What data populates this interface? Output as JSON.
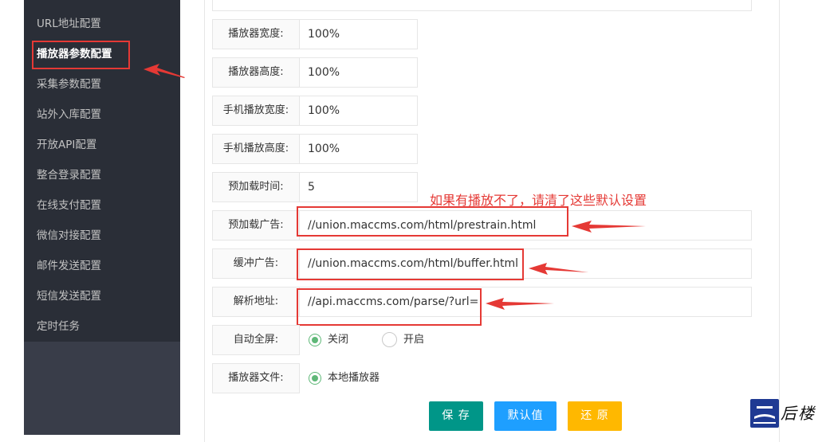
{
  "sidebar": {
    "items": [
      {
        "label": "URL地址配置"
      },
      {
        "label": "播放器参数配置"
      },
      {
        "label": "采集参数配置"
      },
      {
        "label": "站外入库配置"
      },
      {
        "label": "开放API配置"
      },
      {
        "label": "整合登录配置"
      },
      {
        "label": "在线支付配置"
      },
      {
        "label": "微信对接配置"
      },
      {
        "label": "邮件发送配置"
      },
      {
        "label": "短信发送配置"
      },
      {
        "label": "定时任务"
      }
    ],
    "active_index": 1
  },
  "form": {
    "player_width": {
      "label": "播放器宽度:",
      "value": "100%"
    },
    "player_height": {
      "label": "播放器高度:",
      "value": "100%"
    },
    "mobile_width": {
      "label": "手机播放宽度:",
      "value": "100%"
    },
    "mobile_height": {
      "label": "手机播放高度:",
      "value": "100%"
    },
    "preload_time": {
      "label": "预加载时间:",
      "value": "5"
    },
    "preload_ad": {
      "label": "预加载广告:",
      "value": "//union.maccms.com/html/prestrain.html"
    },
    "buffer_ad": {
      "label": "缓冲广告:",
      "value": "//union.maccms.com/html/buffer.html"
    },
    "parse_url": {
      "label": "解析地址:",
      "value": "//api.maccms.com/parse/?url="
    },
    "auto_fullscreen": {
      "label": "自动全屏:",
      "options": [
        "关闭",
        "开启"
      ],
      "selected": "关闭"
    },
    "player_file": {
      "label": "播放器文件:",
      "options": [
        "本地播放器"
      ],
      "selected": "本地播放器"
    }
  },
  "buttons": {
    "save": "保 存",
    "default": "默认值",
    "reset": "还 原"
  },
  "annotation": "如果有播放不了，请清了这些默认设置",
  "watermark": {
    "text": "后楼"
  },
  "colors": {
    "sidebar_bg": "#2a2e37",
    "save_btn": "#009688",
    "default_btn": "#1e9fff",
    "reset_btn": "#ffb800",
    "highlight_red": "#e53935",
    "radio_green": "#5fb878"
  }
}
